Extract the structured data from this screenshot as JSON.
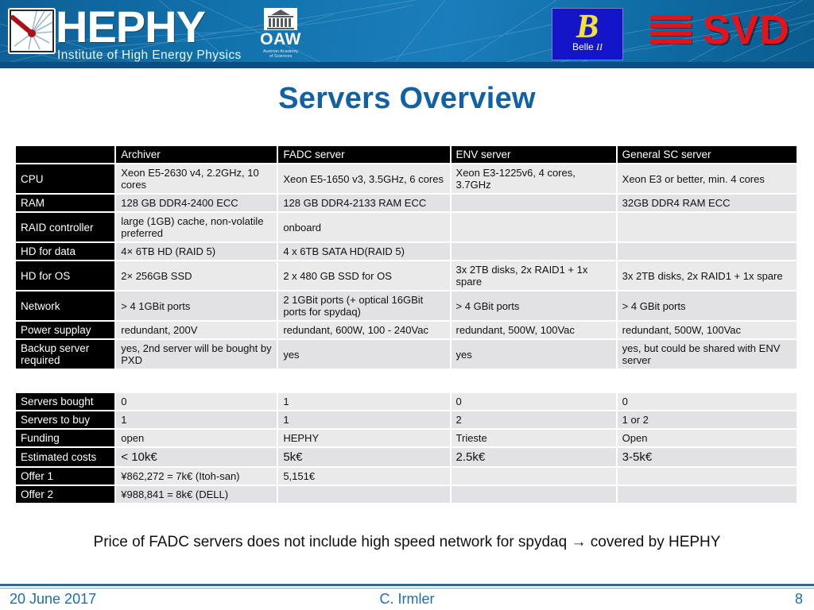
{
  "banner": {
    "hephy": {
      "name": "HEPHY",
      "subtitle": "Institute of High Energy Physics",
      "mark_icon": "hephy-detector-icon"
    },
    "oaw": {
      "name": "OAW",
      "subtitle_line1": "Austrian Academy",
      "subtitle_line2": "of Sciences",
      "building_icon": "oaw-building-icon"
    },
    "belle": {
      "symbol": "B",
      "label": "Belle",
      "label_numeral": "II"
    },
    "svd": {
      "name": "SVD",
      "bars_icon": "svd-bars-icon"
    },
    "colors": {
      "banner_blue": "#1273ad",
      "svd_red": "#e8131a",
      "belle_yellow": "#f2e23a",
      "belle_blue": "#1414c8"
    }
  },
  "slide": {
    "title": "Servers Overview",
    "title_color": "#1062a4",
    "footnote": "Price of FADC servers does not include high speed network for spydaq → covered by HEPHY"
  },
  "spec_table": {
    "columns": [
      "",
      "Archiver",
      "FADC server",
      "ENV server",
      "General SC server"
    ],
    "rows": [
      {
        "label": "CPU",
        "cells": [
          "Xeon E5-2630 v4, 2.2GHz, 10 cores",
          "Xeon E5-1650 v3, 3.5GHz, 6 cores",
          "Xeon E3-1225v6, 4 cores, 3.7GHz",
          "Xeon E3 or better,  min. 4 cores"
        ]
      },
      {
        "label": "RAM",
        "cells": [
          "128 GB DDR4-2400 ECC",
          "128 GB DDR4-2133 RAM ECC",
          "",
          "32GB DDR4 RAM ECC"
        ]
      },
      {
        "label": "RAID controller",
        "cells": [
          "large (1GB) cache, non-volatile preferred",
          "onboard",
          "",
          ""
        ]
      },
      {
        "label": "HD for data",
        "cells": [
          "4× 6TB HD (RAID 5)",
          "4 x 6TB SATA HD(RAID 5)",
          "",
          ""
        ]
      },
      {
        "label": "HD for OS",
        "cells": [
          "2× 256GB SSD",
          "2 x 480 GB SSD for OS",
          "3x 2TB disks, 2x RAID1 + 1x spare",
          "3x 2TB disks, 2x RAID1 + 1x spare"
        ]
      },
      {
        "label": "Network",
        "cells": [
          "> 4 1GBit ports",
          "2 1GBit ports (+ optical 16GBit ports for spydaq)",
          "> 4 GBit ports",
          "> 4 GBit ports"
        ]
      },
      {
        "label": "Power supplay",
        "cells": [
          "redundant, 200V",
          "redundant, 600W, 100 - 240Vac",
          "redundant, 500W, 100Vac",
          "redundant, 500W, 100Vac"
        ]
      },
      {
        "label": "Backup server required",
        "cells": [
          "yes, 2nd server will be bought by PXD",
          "yes",
          "yes",
          "yes, but could be shared with ENV server"
        ]
      }
    ]
  },
  "cost_table": {
    "rows": [
      {
        "label": "Servers bought",
        "bold": false,
        "cells": [
          "0",
          "1",
          "0",
          "0"
        ]
      },
      {
        "label": "Servers to buy",
        "bold": false,
        "cells": [
          "1",
          "1",
          "2",
          "1 or 2"
        ]
      },
      {
        "label": "Funding",
        "bold": false,
        "cells": [
          "open",
          "HEPHY",
          "Trieste",
          "Open"
        ]
      },
      {
        "label": "Estimated costs",
        "bold": true,
        "cells": [
          "< 10k€",
          "5k€",
          "2.5k€",
          "3-5k€"
        ]
      },
      {
        "label": "Offer 1",
        "bold": false,
        "cells": [
          "¥862,272 = 7k€ (Itoh-san)",
          "5,151€",
          "",
          ""
        ]
      },
      {
        "label": "Offer 2",
        "bold": false,
        "cells": [
          "¥988,841 = 8k€ (DELL)",
          "",
          "",
          ""
        ]
      }
    ]
  },
  "footer": {
    "date": "20 June 2017",
    "author": "C. Irmler",
    "page": "8",
    "color": "#1b6fae"
  }
}
